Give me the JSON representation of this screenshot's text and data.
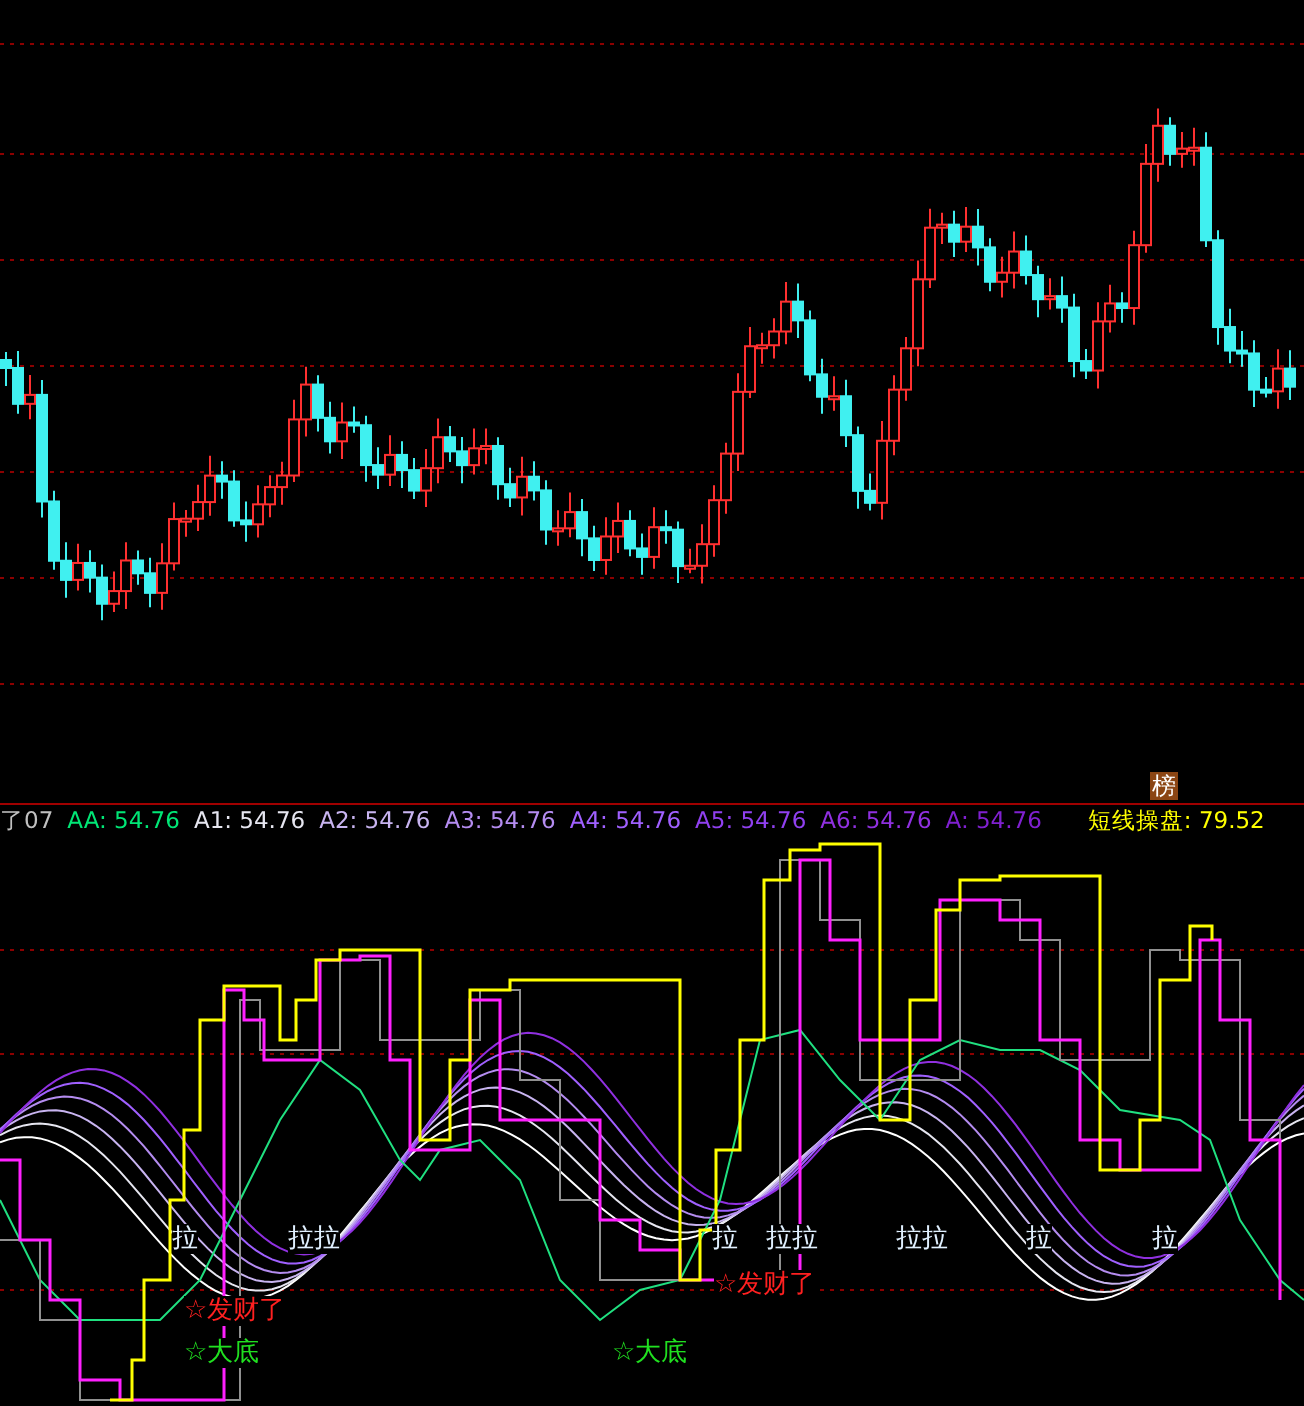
{
  "price_chart": {
    "badge": "榜"
  },
  "indicator": {
    "legend": [
      {
        "text": "了07",
        "color": "#c0c0c0"
      },
      {
        "text": "AA: 54.76",
        "color": "#00e676"
      },
      {
        "text": "A1: 54.76",
        "color": "#e6e6f0"
      },
      {
        "text": "A2: 54.76",
        "color": "#c8b4f0"
      },
      {
        "text": "A3: 54.76",
        "color": "#b48cf0"
      },
      {
        "text": "A4: 54.76",
        "color": "#a060ff"
      },
      {
        "text": "A5: 54.76",
        "color": "#9040f0"
      },
      {
        "text": "A6: 54.76",
        "color": "#9030e0"
      },
      {
        "text": "A: 54.76",
        "color": "#8020d0"
      }
    ],
    "summary": {
      "text": "短线操盘: 79.52",
      "color": "#ffff00"
    },
    "signals": [
      {
        "text": "拉",
        "kind": "pull"
      },
      {
        "text": "拉拉",
        "kind": "pull"
      },
      {
        "text": "☆发财了",
        "kind": "profit"
      },
      {
        "text": "☆大底",
        "kind": "bottom"
      },
      {
        "text": "☆大底",
        "kind": "bottom"
      },
      {
        "text": "拉",
        "kind": "pull"
      },
      {
        "text": "拉拉",
        "kind": "pull"
      },
      {
        "text": "☆发财了",
        "kind": "profit"
      },
      {
        "text": "拉拉",
        "kind": "pull"
      },
      {
        "text": "拉",
        "kind": "pull"
      },
      {
        "text": "拉",
        "kind": "pull"
      }
    ]
  }
}
